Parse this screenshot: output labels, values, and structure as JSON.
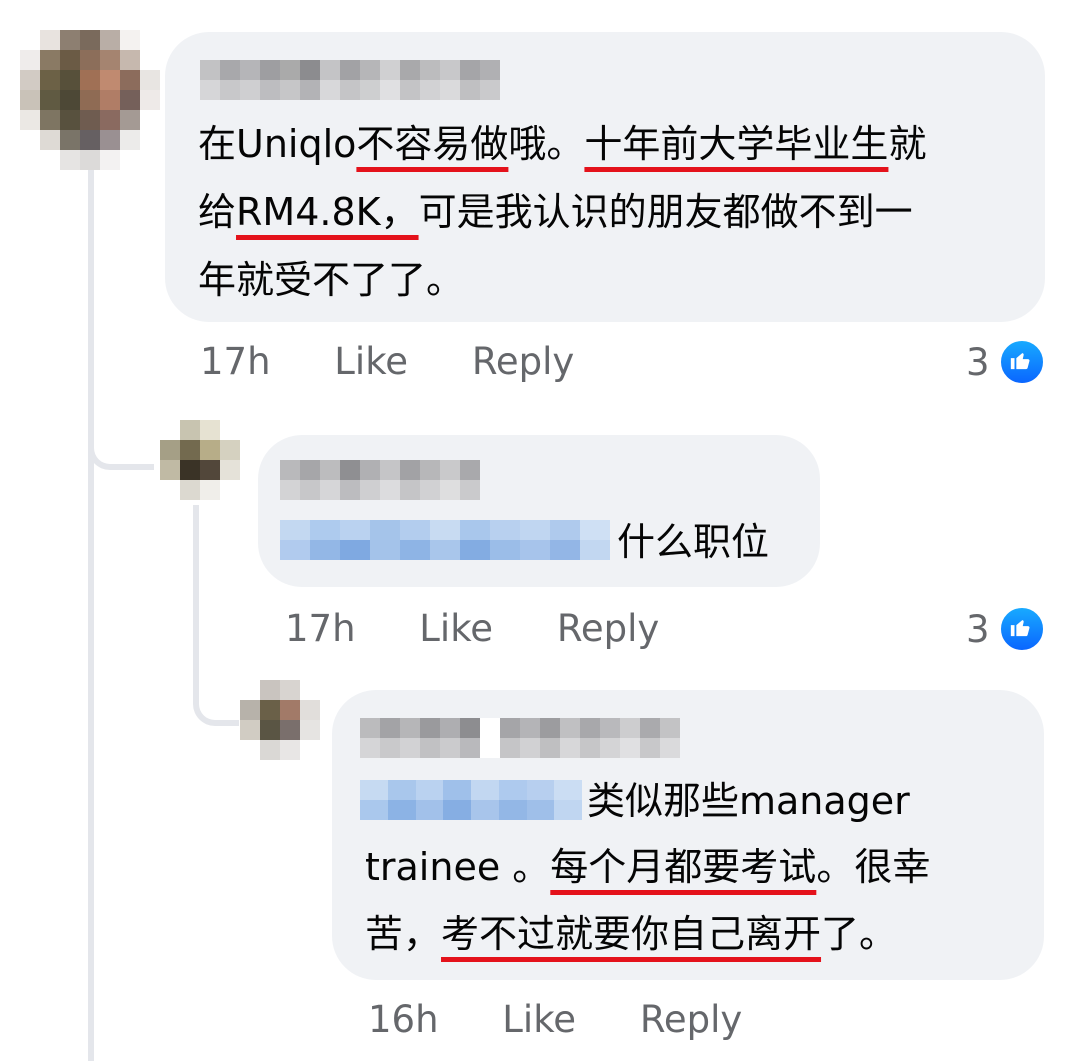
{
  "comments": [
    {
      "text_parts": [
        {
          "t": "在Uniqlo",
          "u": false
        },
        {
          "t": "不容易做",
          "u": true
        },
        {
          "t": "哦。",
          "u": false
        },
        {
          "t": "十年前大学毕业生",
          "u": true
        },
        {
          "t": "就",
          "u": false
        }
      ],
      "line2_parts": [
        {
          "t": "给",
          "u": false
        },
        {
          "t": "RM4.8K，",
          "u": true
        },
        {
          "t": "可是我认识的朋友都做不到一",
          "u": false
        }
      ],
      "line3": "年就受不了了。",
      "time": "17h",
      "like_label": "Like",
      "reply_label": "Reply",
      "reaction_count": "3",
      "reaction_icon": "like-icon"
    },
    {
      "text_suffix": "什么职位",
      "time": "17h",
      "like_label": "Like",
      "reply_label": "Reply",
      "reaction_count": "3",
      "reaction_icon": "like-icon"
    },
    {
      "line1_suffix": "类似那些manager",
      "line2_a": "trainee 。",
      "line2_u": "每个月都要考试",
      "line2_b": "。很幸",
      "line3_a": "苦，",
      "line3_u": "考不过就要你自己离开",
      "line3_b": "了。",
      "time": "16h",
      "like_label": "Like",
      "reply_label": "Reply"
    }
  ],
  "colors": {
    "bubble": "#f0f2f5",
    "meta_text": "#65676b",
    "underline": "#e4121b",
    "like_blue": "#0a66ff"
  }
}
